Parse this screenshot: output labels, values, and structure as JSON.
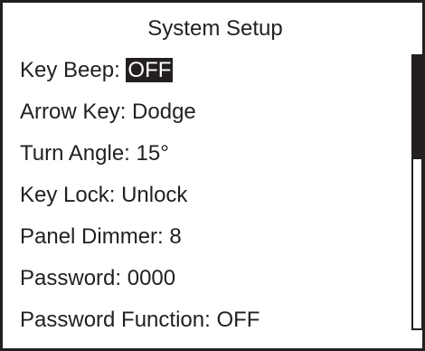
{
  "screen": {
    "title": "System Setup"
  },
  "menu": {
    "items": [
      {
        "label": "Key Beep:",
        "value": "OFF",
        "selected": true
      },
      {
        "label": "Arrow Key:",
        "value": "Dodge",
        "selected": false
      },
      {
        "label": "Turn Angle:",
        "value": "15°",
        "selected": false
      },
      {
        "label": "Key Lock:",
        "value": "Unlock",
        "selected": false
      },
      {
        "label": "Panel Dimmer:",
        "value": "8",
        "selected": false
      },
      {
        "label": "Password:",
        "value": "0000",
        "selected": false
      },
      {
        "label": "Password Function:",
        "value": "OFF",
        "selected": false
      }
    ]
  },
  "scrollbar": {
    "position_fraction": 0.0,
    "visible_fraction": 0.38
  },
  "colors": {
    "foreground": "#231f20",
    "background": "#ffffff",
    "selection_background": "#231f20",
    "selection_text": "#ffffff"
  }
}
